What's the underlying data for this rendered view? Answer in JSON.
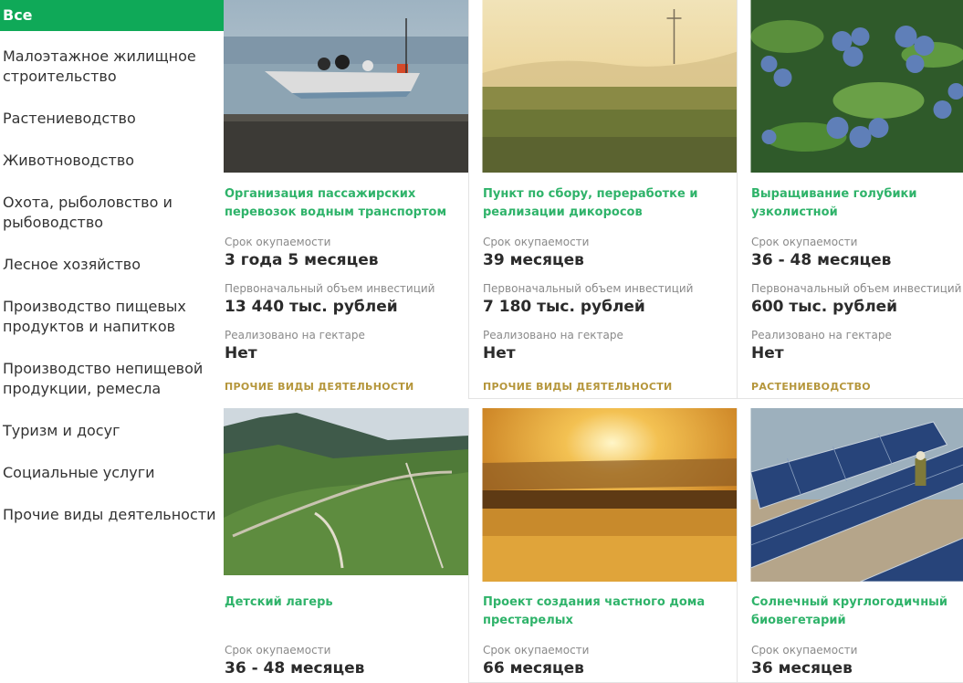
{
  "sidebar": {
    "items": [
      {
        "label": "Все",
        "active": true
      },
      {
        "label": "Малоэтажное жилищное\nстроительство"
      },
      {
        "label": "Растениеводство"
      },
      {
        "label": "Животноводство"
      },
      {
        "label": "Охота, рыболовство и\nрыбоводство"
      },
      {
        "label": "Лесное хозяйство"
      },
      {
        "label": "Производство пищевых\nпродуктов и напитков"
      },
      {
        "label": "Производство непищевой\nпродукции, ремесла"
      },
      {
        "label": "Туризм и досуг"
      },
      {
        "label": "Социальные услуги"
      },
      {
        "label": "Прочие виды деятельности"
      }
    ]
  },
  "labels": {
    "payback": "Срок окупаемости",
    "investment": "Первоначальный объем инвестиций",
    "hectare": "Реализовано на гектаре"
  },
  "cards": [
    {
      "title": "Организация пассажирских\nперевозок водным транспортом",
      "payback": "3 года 5 месяцев",
      "investment": "13 440 тыс. рублей",
      "hectare": "Нет",
      "category": "ПРОЧИЕ ВИДЫ ДЕЯТЕЛЬНОСТИ",
      "image": "boat-photo"
    },
    {
      "title": "Пункт по сбору, переработке и\nреализации дикоросов",
      "payback": "39 месяцев",
      "investment": "7 180 тыс. рублей",
      "hectare": "Нет",
      "category": "ПРОЧИЕ ВИДЫ ДЕЯТЕЛЬНОСТИ",
      "image": "meadow-photo"
    },
    {
      "title": "Выращивание голубики\nузколистной",
      "payback": "36 - 48 месяцев",
      "investment": "600 тыс. рублей",
      "hectare": "Нет",
      "category": "РАСТЕНИЕВОДСТВО",
      "image": "blueberry-photo"
    },
    {
      "title": "Детский лагерь",
      "payback": "36 - 48 месяцев",
      "image": "valley-photo"
    },
    {
      "title": "Проект создания частного дома\nпрестарелых",
      "payback": "66 месяцев",
      "image": "sunset-field-photo"
    },
    {
      "title": "Солнечный круглогодичный\nбиовегетарий",
      "payback": "36 месяцев",
      "image": "solar-panels-photo"
    }
  ],
  "colors": {
    "accent": "#0fa958",
    "title": "#2fb36a",
    "category": "#b5963b"
  }
}
